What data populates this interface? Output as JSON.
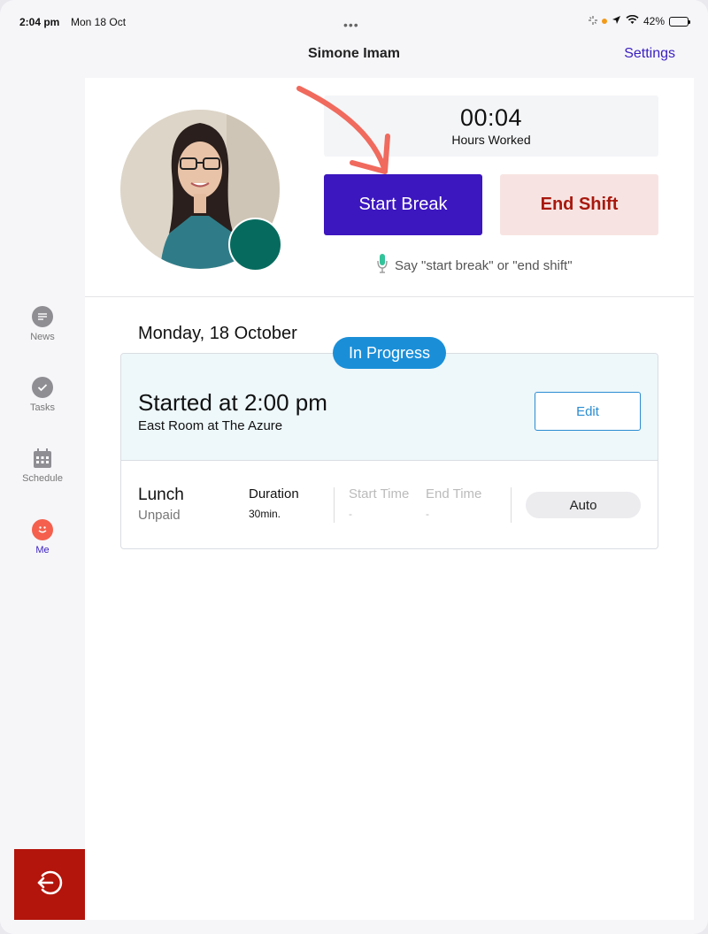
{
  "status_bar": {
    "time": "2:04 pm",
    "date": "Mon 18 Oct",
    "battery": "42%"
  },
  "nav": {
    "title": "Simone Imam",
    "settings": "Settings"
  },
  "sidebar": {
    "items": [
      {
        "label": "News",
        "icon": "news-icon"
      },
      {
        "label": "Tasks",
        "icon": "check-icon"
      },
      {
        "label": "Schedule",
        "icon": "calendar-icon"
      },
      {
        "label": "Me",
        "icon": "smiley-icon",
        "active": true
      }
    ],
    "logout_icon": "logout-icon"
  },
  "timer": {
    "value": "00:04",
    "label": "Hours Worked"
  },
  "actions": {
    "start_break": "Start Break",
    "end_shift": "End Shift"
  },
  "voice_hint": "Say \"start break\" or \"end shift\"",
  "shift": {
    "date": "Monday, 18 October",
    "status": "In Progress",
    "started": "Started at 2:00 pm",
    "location": "East Room at The Azure",
    "edit_label": "Edit",
    "break": {
      "name": "Lunch",
      "type": "Unpaid",
      "duration_label": "Duration",
      "duration_value": "30min.",
      "start_label": "Start Time",
      "start_value": "-",
      "end_label": "End Time",
      "end_value": "-",
      "mode": "Auto"
    }
  },
  "colors": {
    "accent": "#3c16bf",
    "danger": "#a8180e",
    "info": "#1a8fd8",
    "online": "#066b5e",
    "logout": "#b3140b"
  }
}
